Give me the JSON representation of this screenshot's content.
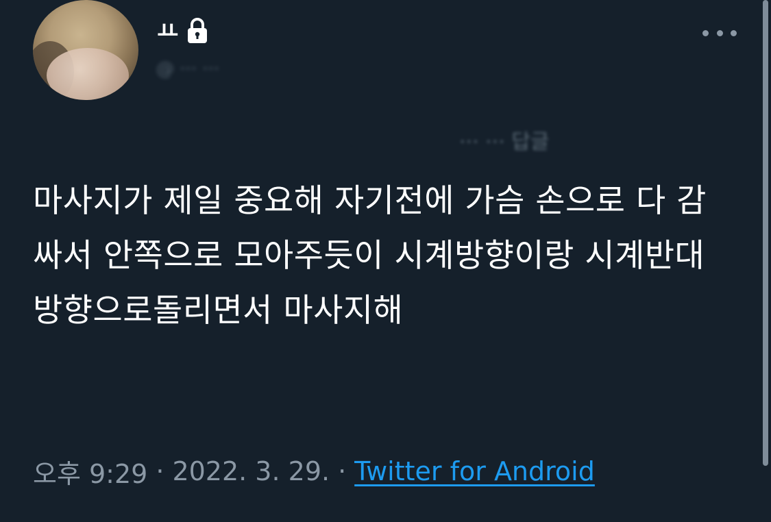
{
  "tweet": {
    "author_name": "ㅛ",
    "handle": "@ ··· ···",
    "context_label": "··· ··· 답글",
    "text": "마사지가 제일 중요해 자기전에 가슴 손으로 다 감싸서 안쪽으로 모아주듯이 시계방향이랑 시계반대방향으로돌리면서 마사지해",
    "time": "오후 9:29",
    "separator": "·",
    "date": "2022. 3. 29.",
    "source": "Twitter for Android"
  },
  "icons": {
    "lock": "lock-icon",
    "more": "more-horizontal-icon"
  },
  "colors": {
    "background": "#15202b",
    "text_primary": "#ffffff",
    "text_secondary": "#8b98a5",
    "link": "#1d9bf0"
  }
}
